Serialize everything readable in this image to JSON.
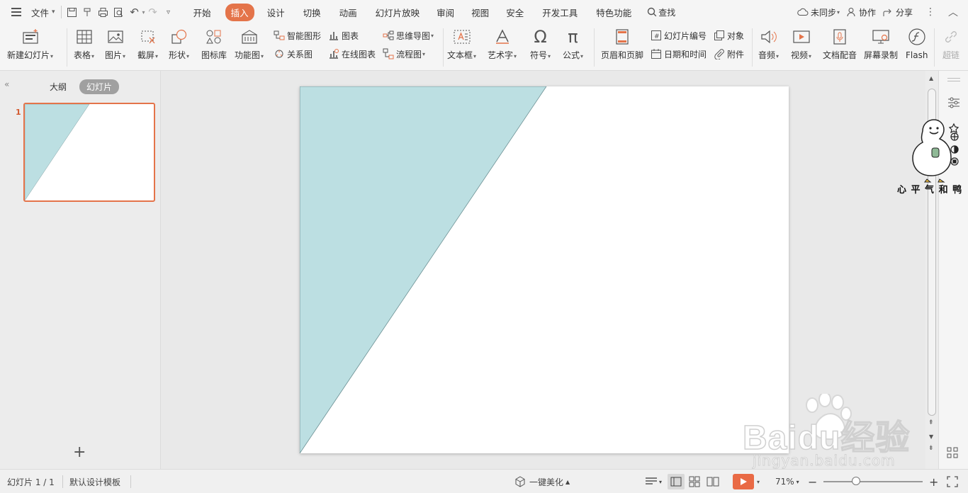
{
  "menu": {
    "file": "文件",
    "tabs": [
      "开始",
      "插入",
      "设计",
      "切换",
      "动画",
      "幻灯片放映",
      "审阅",
      "视图",
      "安全",
      "开发工具",
      "特色功能"
    ],
    "active_tab": "插入",
    "search": "查找",
    "sync": "未同步",
    "collab": "协作",
    "share": "分享"
  },
  "ribbon": {
    "new_slide": "新建幻灯片",
    "table": "表格",
    "picture": "图片",
    "screenshot": "截屏",
    "shape": "形状",
    "icon_lib": "图标库",
    "func_chart": "功能图",
    "smart_shape": "智能图形",
    "chart": "图表",
    "mindmap": "思维导图",
    "relation": "关系图",
    "online_chart": "在线图表",
    "flowchart": "流程图",
    "textbox": "文本框",
    "wordart": "艺术字",
    "symbol": "符号",
    "formula": "公式",
    "header_footer": "页眉和页脚",
    "slide_number": "幻灯片编号",
    "object": "对象",
    "datetime": "日期和时间",
    "attachment": "附件",
    "audio": "音频",
    "video": "视频",
    "voiceover": "文档配音",
    "screen_record": "屏幕录制",
    "flash": "Flash",
    "hyperlink": "超链"
  },
  "left_panel": {
    "outline_tab": "大纲",
    "slides_tab": "幻灯片",
    "slide_number": "1"
  },
  "slide": {
    "fill_color": "#bcdfe2",
    "background": "#ffffff"
  },
  "status": {
    "slide_info": "幻灯片 1 / 1",
    "template": "默认设计模板",
    "beautify": "一键美化",
    "zoom": "71%",
    "zoom_level": 0.33
  },
  "sticker": {
    "caption": "心 平 气 和 鸭"
  },
  "watermark": {
    "brand": "Baidu经验",
    "url": "jingyan.baidu.com"
  },
  "colors": {
    "accent": "#e4744a",
    "play": "#e96a45"
  }
}
